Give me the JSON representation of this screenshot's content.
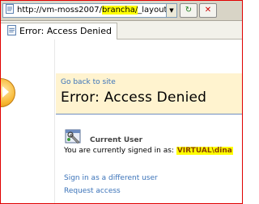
{
  "address_bar": {
    "url_prefix": "http://vm-moss2007/",
    "url_highlight": "brancha/",
    "url_suffix": "_layouts/Acc"
  },
  "toolbar": {
    "dropdown_glyph": "▼",
    "refresh_glyph": "↻",
    "stop_glyph": "✕"
  },
  "tab": {
    "title": "Error: Access Denied"
  },
  "page": {
    "go_back_link": "Go back to site",
    "title": "Error: Access Denied",
    "current_user_label": "Current User",
    "signed_in_text": "You are currently signed in as:",
    "account": "VIRTUAL\\dina",
    "sign_in_different_link": "Sign in as a different user",
    "request_access_link": "Request access"
  },
  "colors": {
    "frame_border": "#e00000",
    "title_band": "#fff3cf",
    "link": "#3b73b9",
    "highlight": "#ffff00"
  }
}
